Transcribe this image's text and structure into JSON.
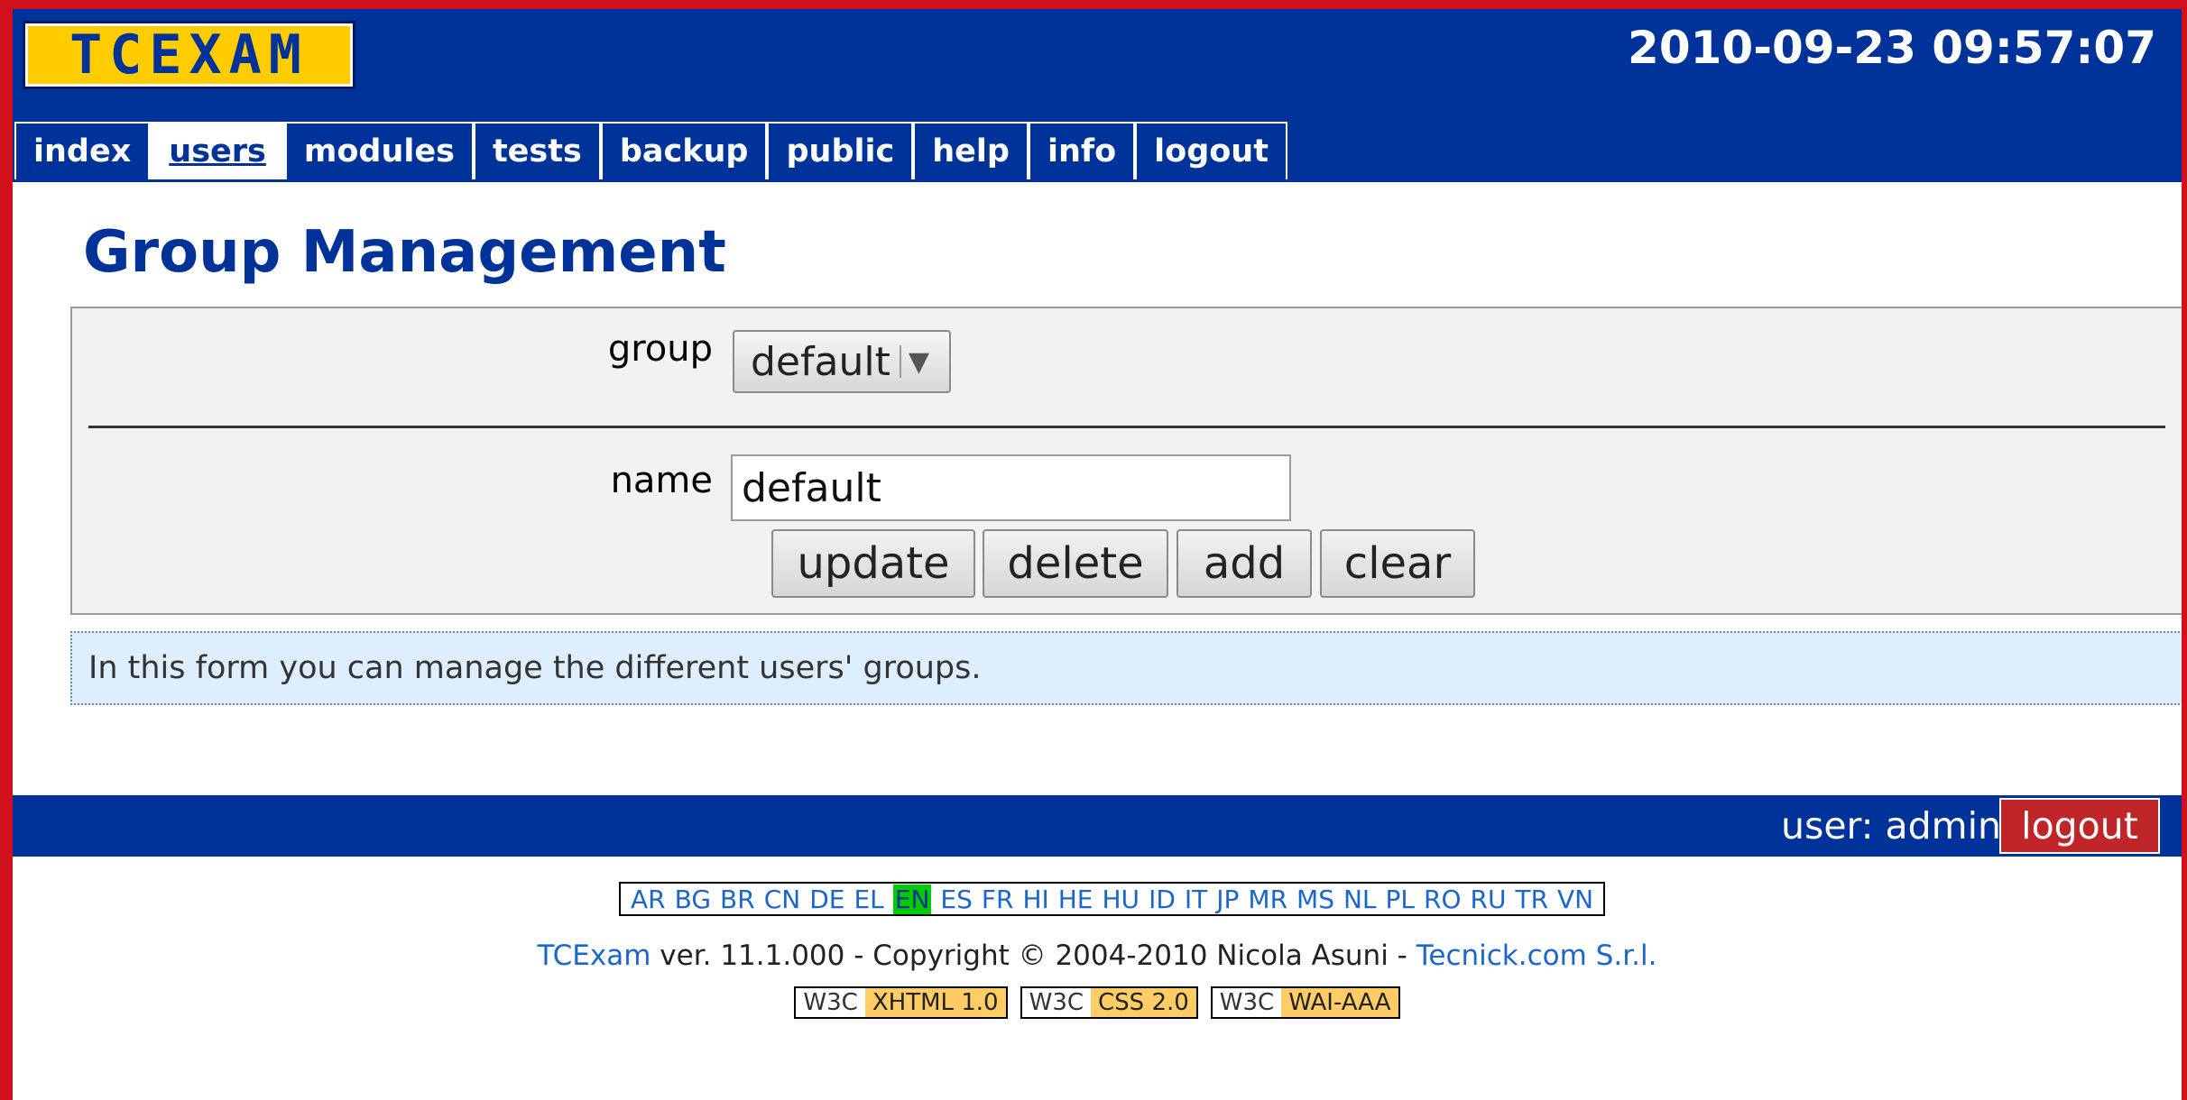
{
  "header": {
    "logo_text": "TCEXAM",
    "datetime": "2010-09-23 09:57:07"
  },
  "menu": {
    "items": [
      {
        "label": "index",
        "active": false
      },
      {
        "label": "users",
        "active": true
      },
      {
        "label": "modules",
        "active": false
      },
      {
        "label": "tests",
        "active": false
      },
      {
        "label": "backup",
        "active": false
      },
      {
        "label": "public",
        "active": false
      },
      {
        "label": "help",
        "active": false
      },
      {
        "label": "info",
        "active": false
      },
      {
        "label": "logout",
        "active": false
      }
    ]
  },
  "page": {
    "title": "Group Management"
  },
  "form": {
    "group_label": "group",
    "group_selected": "default",
    "name_label": "name",
    "name_value": "default",
    "buttons": {
      "update": "update",
      "delete": "delete",
      "add": "add",
      "clear": "clear"
    }
  },
  "help_text": "In this form you can manage the different users' groups.",
  "userbar": {
    "user_text": "user: admin",
    "logout_label": "logout"
  },
  "languages": {
    "items": [
      "AR",
      "BG",
      "BR",
      "CN",
      "DE",
      "EL",
      "EN",
      "ES",
      "FR",
      "HI",
      "HE",
      "HU",
      "ID",
      "IT",
      "JP",
      "MR",
      "MS",
      "NL",
      "PL",
      "RO",
      "RU",
      "TR",
      "VN"
    ],
    "active": "EN"
  },
  "footer": {
    "app_link": "TCExam",
    "version_text": " ver. 11.1.000 - Copyright © 2004-2010 Nicola Asuni - ",
    "company_link": "Tecnick.com S.r.l."
  },
  "w3c": {
    "badges": [
      {
        "left": "W3C",
        "right": "XHTML 1.0"
      },
      {
        "left": "W3C",
        "right": "CSS 2.0"
      },
      {
        "left": "W3C",
        "right": "WAI-AAA"
      }
    ]
  },
  "colors": {
    "header_bg": "#003399",
    "frame_border": "#d0101a",
    "logo_bg": "#ffcc00",
    "logout_bg": "#c0252a",
    "help_bg": "#ddeeff",
    "active_lang_bg": "#00cc00",
    "badge_accent": "#ffcc66"
  }
}
